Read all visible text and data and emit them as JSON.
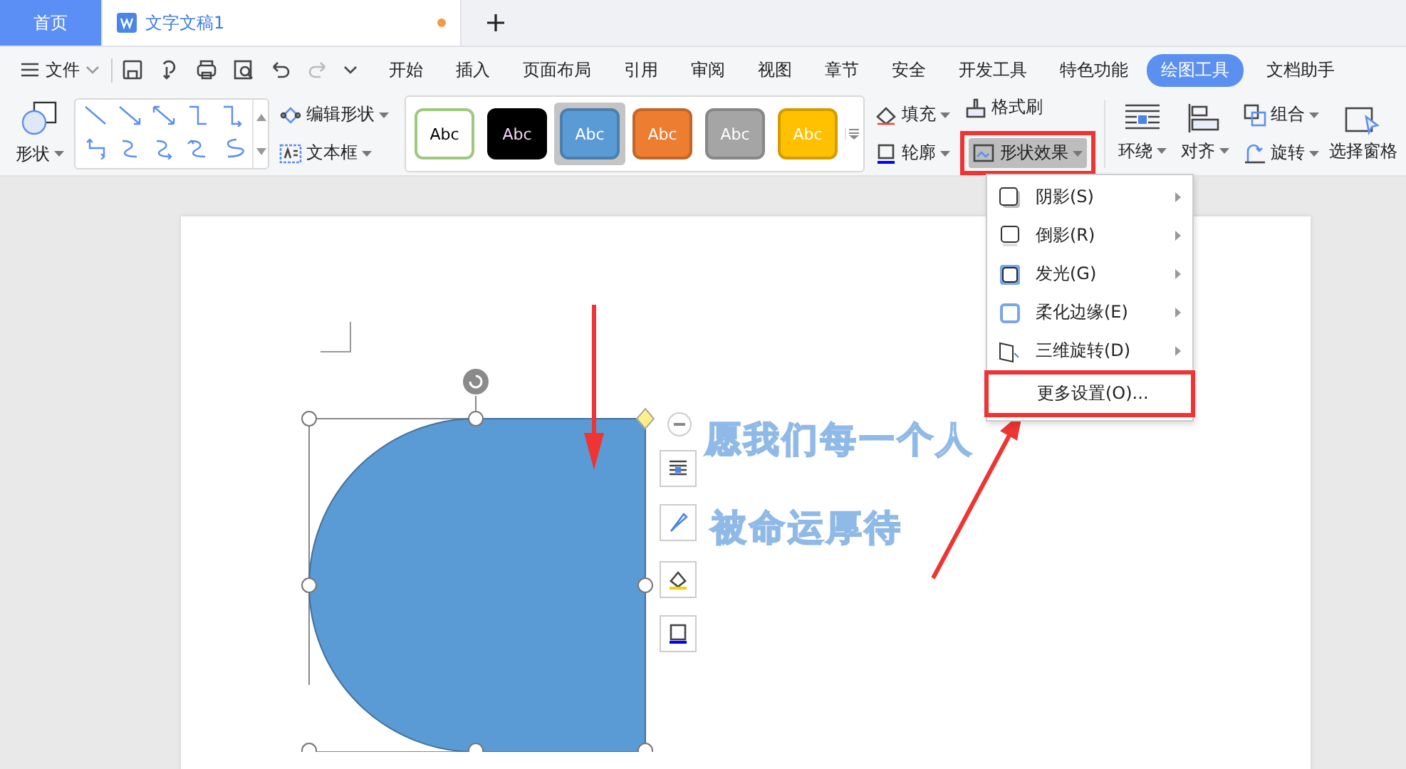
{
  "tabs": [
    {
      "label": "首页",
      "selected": false,
      "unsaved": false
    },
    {
      "label": "文字文稿1",
      "selected": true,
      "unsaved": true
    }
  ],
  "menu_bar": {
    "file": "文件",
    "tabs": [
      {
        "label": "开始",
        "selected": false
      },
      {
        "label": "插入",
        "selected": false
      },
      {
        "label": "页面布局",
        "selected": false
      },
      {
        "label": "引用",
        "selected": false
      },
      {
        "label": "审阅",
        "selected": false
      },
      {
        "label": "视图",
        "selected": false
      },
      {
        "label": "章节",
        "selected": false
      },
      {
        "label": "安全",
        "selected": false
      },
      {
        "label": "开发工具",
        "selected": false
      },
      {
        "label": "特色功能",
        "selected": false
      },
      {
        "label": "绘图工具",
        "selected": true
      },
      {
        "label": "文档助手",
        "selected": false
      }
    ]
  },
  "ribbon": {
    "shape": "形状",
    "edit_shape": "编辑形状",
    "text_box": "文本框",
    "styles": [
      {
        "label": "Abc",
        "color": "#ffffff",
        "selected": false
      },
      {
        "label": "Abc",
        "color": "#000000",
        "selected": false
      },
      {
        "label": "Abc",
        "color": "#5b9bd5",
        "selected": true
      },
      {
        "label": "Abc",
        "color": "#ed7d31",
        "selected": false
      },
      {
        "label": "Abc",
        "color": "#a5a5a5",
        "selected": false
      },
      {
        "label": "Abc",
        "color": "#ffc000",
        "selected": false
      }
    ],
    "fill": "填充",
    "outline": "轮廓",
    "format_painter": "格式刷",
    "shape_effects": {
      "label": "形状效果",
      "pressed": true
    },
    "wrap": "环绕",
    "align": "对齐",
    "group": "组合",
    "rotate": "旋转",
    "selection_pane": "选择窗格"
  },
  "effects_menu": [
    {
      "kind": "shadow",
      "label": "阴影(S)",
      "submenu": true
    },
    {
      "kind": "reflection",
      "label": "倒影(R)",
      "submenu": true
    },
    {
      "kind": "glow",
      "label": "发光(G)",
      "submenu": true
    },
    {
      "kind": "soft",
      "label": "柔化边缘(E)",
      "submenu": true
    },
    {
      "kind": "rotate3d",
      "label": "三维旋转(D)",
      "submenu": true
    },
    {
      "kind": "plain",
      "label": "更多设置(O)...",
      "submenu": false
    }
  ],
  "document": {
    "lines": [
      "愿我们每一个人",
      "被命运厚待"
    ]
  }
}
